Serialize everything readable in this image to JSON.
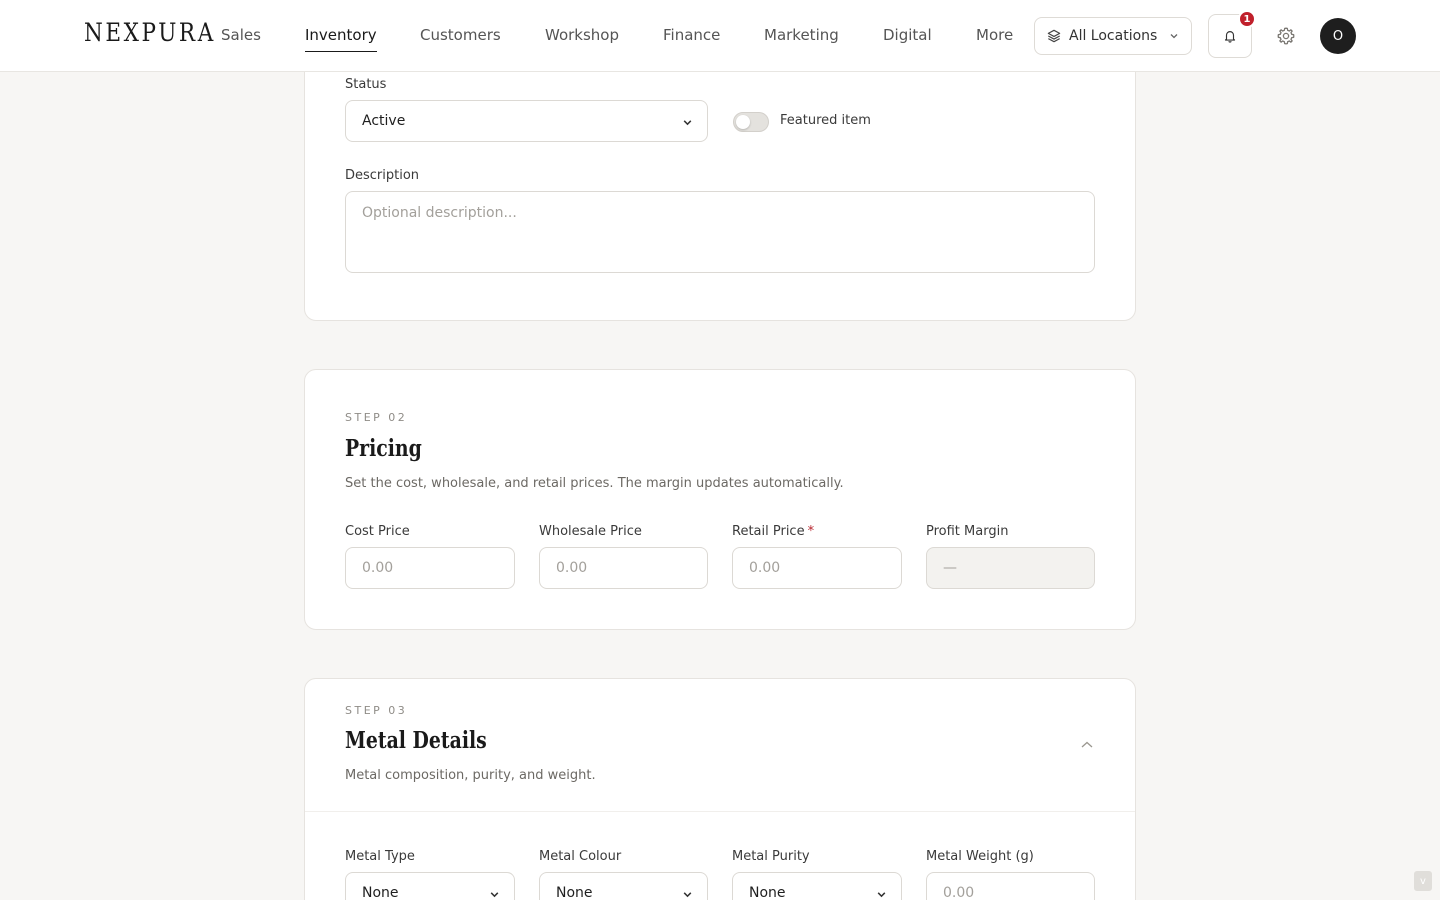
{
  "brand": "NEXPURA",
  "nav": {
    "items": [
      {
        "label": "Sales"
      },
      {
        "label": "Inventory"
      },
      {
        "label": "Customers"
      },
      {
        "label": "Workshop"
      },
      {
        "label": "Finance"
      },
      {
        "label": "Marketing"
      },
      {
        "label": "Digital"
      },
      {
        "label": "More"
      }
    ],
    "active": "Inventory",
    "location": "All Locations",
    "notification_count": "1",
    "avatar_initial": "O"
  },
  "basics": {
    "status_label": "Status",
    "status_value": "Active",
    "featured_label": "Featured item",
    "featured_on": false,
    "description_label": "Description",
    "description_placeholder": "Optional description..."
  },
  "pricing": {
    "step": "STEP 02",
    "title": "Pricing",
    "description": "Set the cost, wholesale, and retail prices. The margin updates automatically.",
    "fields": [
      {
        "label": "Cost Price",
        "placeholder": "0.00",
        "required": false
      },
      {
        "label": "Wholesale Price",
        "placeholder": "0.00",
        "required": false
      },
      {
        "label": "Retail Price",
        "placeholder": "0.00",
        "required": true
      },
      {
        "label": "Profit Margin",
        "placeholder": "—",
        "required": false
      }
    ],
    "required_mark": "*"
  },
  "metal": {
    "step": "STEP 03",
    "title": "Metal Details",
    "description": "Metal composition, purity, and weight.",
    "fields": [
      {
        "label": "Metal Type",
        "value": "None"
      },
      {
        "label": "Metal Colour",
        "value": "None"
      },
      {
        "label": "Metal Purity",
        "value": "None"
      },
      {
        "label": "Metal Weight (g)",
        "placeholder": "0.00"
      }
    ]
  },
  "scroll_hint": "v",
  "icons": {
    "location": "layers-icon",
    "notifications": "bell-icon",
    "settings": "gear-icon",
    "select": "chevron-down-icon",
    "collapse": "chevron-up-icon"
  },
  "colors": {
    "background": "#f7f6f4",
    "card": "#ffffff",
    "badge": "#c0202b",
    "required": "#b8262f",
    "avatar": "#1e1e1e"
  }
}
